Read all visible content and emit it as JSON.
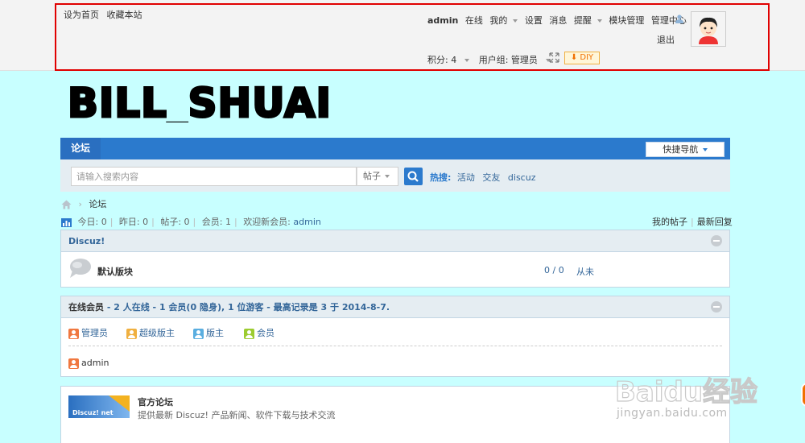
{
  "topbar": {
    "set_home": "设为首页",
    "bookmark": "收藏本站",
    "username": "admin",
    "online": "在线",
    "mine": "我的",
    "settings": "设置",
    "messages": "消息",
    "reminders": "提醒",
    "module_manage": "模块管理",
    "admin_center": "管理中心",
    "logout": "退出",
    "credits": "积分: 4",
    "user_group": "用户组: 管理员",
    "diy": "DIY"
  },
  "logo": {
    "text": "BILL_SHUAI"
  },
  "nav": {
    "forum_tab": "论坛",
    "quick_nav": "快捷导航"
  },
  "search": {
    "placeholder": "请输入搜索内容",
    "type": "帖子",
    "hot_label": "热搜:",
    "hot_items": [
      "活动",
      "交友",
      "discuz"
    ]
  },
  "breadcrumb": {
    "current": "论坛"
  },
  "stats": {
    "today": "今日: 0",
    "yesterday": "昨日: 0",
    "posts": "帖子: 0",
    "members": "会员: 1",
    "welcome": "欢迎新会员:",
    "new_member": "admin",
    "my_posts": "我的帖子",
    "latest_replies": "最新回复"
  },
  "category": {
    "title": "Discuz!",
    "forum_name": "默认版块",
    "count": "0 / 0",
    "last_post": "从未"
  },
  "online": {
    "title": "在线会员",
    "summary": "- 2 人在线 - 1 会员(0 隐身), 1 位游客 - 最高记录是 3 于 2014-8-7.",
    "legend": [
      {
        "label": "管理员",
        "color": "#f07840"
      },
      {
        "label": "超级版主",
        "color": "#f0b040"
      },
      {
        "label": "版主",
        "color": "#5aaee0"
      },
      {
        "label": "会员",
        "color": "#9ccc30"
      }
    ],
    "users": [
      "admin"
    ]
  },
  "links": {
    "logo_text": "Discuz! net",
    "name": "官方论坛",
    "desc": "提供最新 Discuz! 产品新闻、软件下载与技术交流"
  },
  "watermark": {
    "brand": "Baidu经验",
    "url": "jingyan.baidu.com"
  },
  "icons": {
    "person": "person-icon",
    "expand": "expand-icon",
    "search": "search-icon",
    "home": "home-icon",
    "stats": "bar-chart-icon",
    "collapse": "collapse-icon",
    "forum": "speech-bubble-icon"
  }
}
